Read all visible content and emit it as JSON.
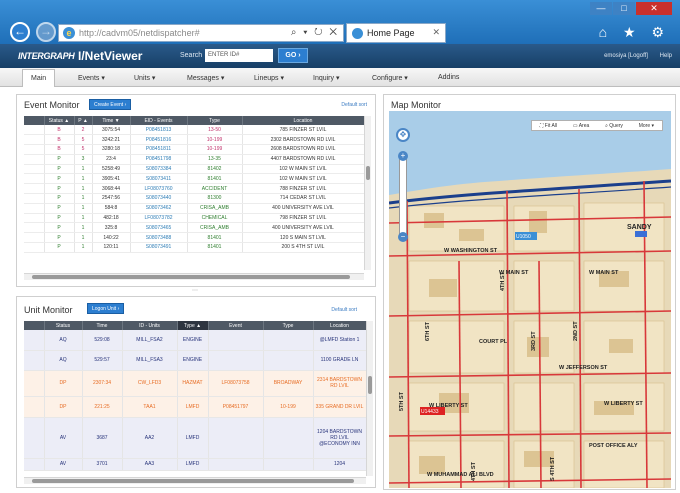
{
  "browser": {
    "window_controls": [
      "—",
      "□",
      "✕"
    ],
    "back_label": "←",
    "forward_label": "→",
    "address": "http://cadvm05/netdispatcher#",
    "address_tools": "⌕ ▾ ↻ ✕",
    "tab_title": "Home Page",
    "tab_close": "✕",
    "toolbar_icons": "⌂ ★ ⚙"
  },
  "app": {
    "logo": "INTERGRAPH",
    "name": "I/NetViewer",
    "search_label": "Search",
    "search_placeholder": "ENTER ID#",
    "go_label": "GO ›",
    "user": "emosiya [Logoff]",
    "help": "Help"
  },
  "menu": [
    {
      "label": "Main"
    },
    {
      "label": "Events ▾"
    },
    {
      "label": "Units ▾"
    },
    {
      "label": "Messages ▾"
    },
    {
      "label": "Lineups ▾"
    },
    {
      "label": "Inquiry ▾"
    },
    {
      "label": "Configure ▾"
    },
    {
      "label": "Addins"
    }
  ],
  "event_monitor": {
    "title": "Event Monitor",
    "create_label": "Create Event ›",
    "default_sort": "Default sort",
    "columns": [
      "Status ▲",
      "P ▲",
      "Time ▼",
      "EID - Events",
      "Type",
      "Location"
    ],
    "rows": [
      {
        "status": "B",
        "p": "2",
        "time": "3075:54",
        "eid": "P08451813",
        "type": "13-50",
        "location": "785 FINZER ST LVIL",
        "tone": "red"
      },
      {
        "status": "B",
        "p": "5",
        "time": "3242:21",
        "eid": "P08451816",
        "type": "10-199",
        "location": "2302 BARDSTOWN RD LVIL",
        "tone": "red"
      },
      {
        "status": "B",
        "p": "5",
        "time": "3280:18",
        "eid": "P08451811",
        "type": "10-199",
        "location": "2608 BARDSTOWN RD LVIL",
        "tone": "red"
      },
      {
        "status": "P",
        "p": "3",
        "time": "23:4",
        "eid": "P08451798",
        "type": "13-35",
        "location": "4407 BARDSTOWN RD LVIL",
        "tone": "green"
      },
      {
        "status": "P",
        "p": "1",
        "time": "5258:49",
        "eid": "S08073384",
        "type": "81402",
        "location": "102 W MAIN ST LVIL",
        "tone": "green"
      },
      {
        "status": "P",
        "p": "1",
        "time": "3905:41",
        "eid": "S08073411",
        "type": "81401",
        "location": "102 W MAIN ST LVIL",
        "tone": "green"
      },
      {
        "status": "P",
        "p": "1",
        "time": "3068:44",
        "eid": "LF08073760",
        "type": "ACCIDENT",
        "location": "788 FINZER ST LVIL",
        "tone": "green"
      },
      {
        "status": "P",
        "p": "1",
        "time": "2547:56",
        "eid": "S08073440",
        "type": "81300",
        "location": "714 CEDAR ST LVIL",
        "tone": "green"
      },
      {
        "status": "P",
        "p": "1",
        "time": "584:8",
        "eid": "S08073462",
        "type": "CRISA_AMB",
        "location": "400 UNIVERSITY AVE LVIL",
        "tone": "green"
      },
      {
        "status": "P",
        "p": "1",
        "time": "482:18",
        "eid": "LF08073782",
        "type": "CHEMICAL",
        "location": "798 FINZER ST LVIL",
        "tone": "green"
      },
      {
        "status": "P",
        "p": "1",
        "time": "325:8",
        "eid": "S08073465",
        "type": "CRISA_AMB",
        "location": "400 UNIVERSITY AVE LVIL",
        "tone": "green"
      },
      {
        "status": "P",
        "p": "1",
        "time": "140:22",
        "eid": "S08073488",
        "type": "81401",
        "location": "120 S MAIN ST LVIL",
        "tone": "green"
      },
      {
        "status": "P",
        "p": "1",
        "time": "120:11",
        "eid": "S08073491",
        "type": "81401",
        "location": "200 S 4TH ST LVIL",
        "tone": "green"
      }
    ]
  },
  "unit_monitor": {
    "title": "Unit Monitor",
    "logon_label": "Logon Unit ›",
    "default_sort": "Default sort",
    "columns": [
      "Status",
      "Time",
      "ID - Units",
      "Type ▲",
      "Event",
      "Type",
      "Location"
    ],
    "rows": [
      {
        "status": "AQ",
        "time": "529:08",
        "id": "MILL_FSA2",
        "type": "ENGINE",
        "event": "",
        "etype": "",
        "location": "@LMFD Station 1",
        "tone": "blue"
      },
      {
        "status": "AQ",
        "time": "529:57",
        "id": "MILL_FSA3",
        "type": "ENGINE",
        "event": "",
        "etype": "",
        "location": "1100 GRADE LN",
        "tone": "blue"
      },
      {
        "status": "DP",
        "time": "2307:34",
        "id": "CW_LFD3",
        "type": "HAZMAT",
        "event": "LF08073758",
        "etype": "BROADWAY",
        "location": "2314 BARDSTOWN RD LVIL",
        "tone": "orange"
      },
      {
        "status": "DP",
        "time": "221:25",
        "id": "TAA1",
        "type": "LMFD",
        "event": "P08451797",
        "etype": "10-199",
        "location": "335 GRAND DR LVIL",
        "tone": "orange"
      },
      {
        "status": "AV",
        "time": "3687",
        "id": "AA2",
        "type": "LMFD",
        "event": "",
        "etype": "",
        "location": "1204 BARDSTOWN RD LVIL @ECONOMY INN",
        "tone": "blue"
      },
      {
        "status": "AV",
        "time": "3701",
        "id": "AA3",
        "type": "LMFD",
        "event": "",
        "etype": "",
        "location": "1204",
        "tone": "blue"
      }
    ]
  },
  "map_monitor": {
    "title": "Map Monitor",
    "toolbar": [
      "⛶ Fit All",
      "▭ Area",
      "⌕ Query",
      "More ▾"
    ],
    "zoom_plus": "+",
    "zoom_minus": "−",
    "pan_icon": "✥",
    "streets_h": [
      "W WASHINGTON ST",
      "W MAIN ST",
      "W MAIN ST",
      "COURT PL",
      "W JEFFERSON ST",
      "W LIBERTY ST",
      "W LIBERTY ST",
      "POST OFFICE ALY",
      "W MUHAMMAD ALI BLVD"
    ],
    "streets_v": [
      "5TH ST",
      "6TH ST",
      "4TH ST",
      "3RD ST",
      "2ND ST",
      "4TH ST",
      "S 4TH ST"
    ],
    "place_labels": [
      "SANDY"
    ],
    "markers": [
      {
        "label": "U1050",
        "color": "#3a8fd6"
      },
      {
        "label": "U14433",
        "color": "#d22"
      }
    ],
    "colors": {
      "land": "#e7d9b8",
      "water": "#a9cde8",
      "block": "#f1e4c4",
      "road": "#d8383a",
      "building": "#d8bf8c"
    }
  }
}
